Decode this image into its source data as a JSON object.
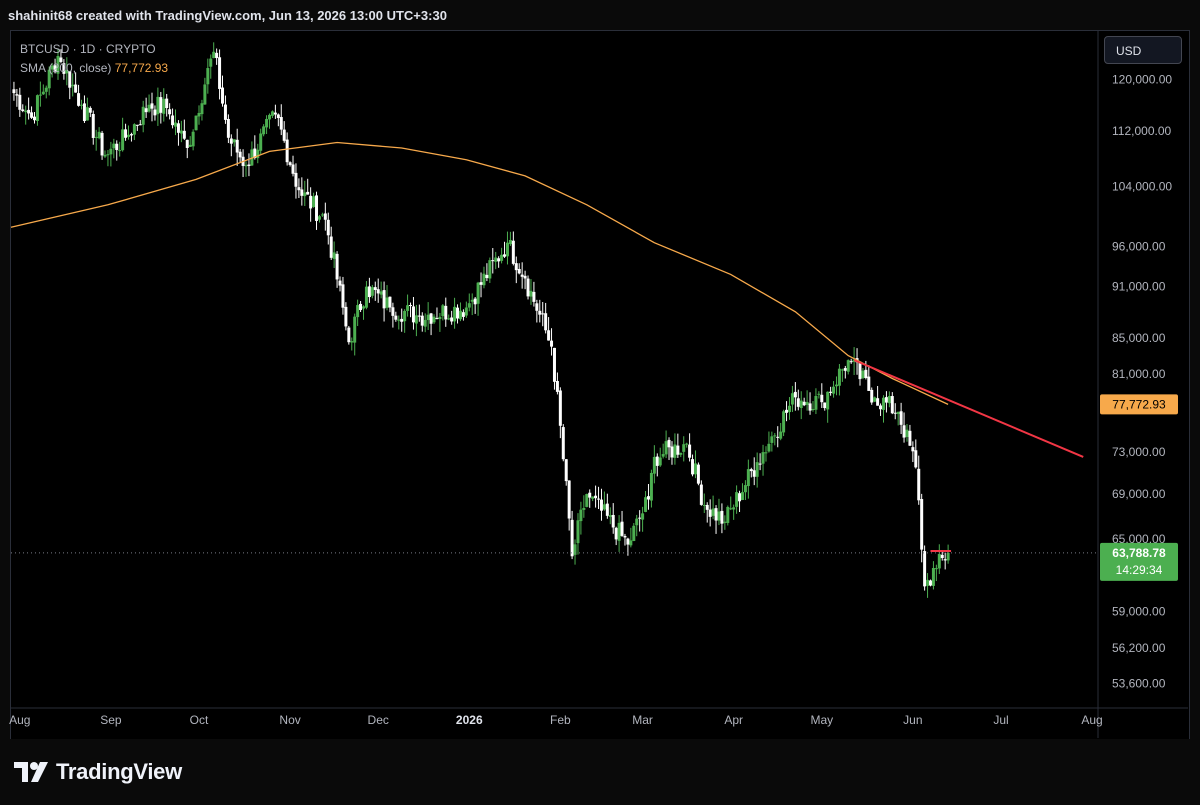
{
  "header": {
    "attribution": "shahinit68 created with TradingView.com, Jun 13, 2026 13:00 UTC+3:30"
  },
  "legend": {
    "symbol": "BTCUSD · 1D · CRYPTO",
    "sma_label": "SMA (200, close)",
    "sma_value": "77,772.93"
  },
  "currency_button": "USD",
  "footer": {
    "brand": "TradingView",
    "logo_icon": "tradingview-logo-icon"
  },
  "colors": {
    "up": "#26a69a",
    "up_candle": "#4caf50",
    "down_candle": "#ffffff",
    "sma": "#f7a94b",
    "trendline": "#f23645",
    "price_badge": "#4caf50",
    "sma_badge": "#f7a94b"
  },
  "chart_data": {
    "type": "candlestick",
    "symbol": "BTCUSD",
    "interval": "1D",
    "ylim": [
      52000,
      128000
    ],
    "y_ticks": [
      {
        "value": 120000,
        "label": "120,000.00"
      },
      {
        "value": 112000,
        "label": "112,000.00"
      },
      {
        "value": 104000,
        "label": "104,000.00"
      },
      {
        "value": 96000,
        "label": "96,000.00"
      },
      {
        "value": 91000,
        "label": "91,000.00"
      },
      {
        "value": 85000,
        "label": "85,000.00"
      },
      {
        "value": 81000,
        "label": "81,000.00"
      },
      {
        "value": 73000,
        "label": "73,000.00"
      },
      {
        "value": 69000,
        "label": "69,000.00"
      },
      {
        "value": 65000,
        "label": "65,000.00"
      },
      {
        "value": 59000,
        "label": "59,000.00"
      },
      {
        "value": 56200,
        "label": "56,200.00"
      },
      {
        "value": 53600,
        "label": "53,600.00"
      }
    ],
    "x_ticks": [
      {
        "date": "2025-08-01",
        "label": "Aug",
        "bold": false
      },
      {
        "date": "2025-09-01",
        "label": "Sep",
        "bold": false
      },
      {
        "date": "2025-10-01",
        "label": "Oct",
        "bold": false
      },
      {
        "date": "2025-11-01",
        "label": "Nov",
        "bold": false
      },
      {
        "date": "2025-12-01",
        "label": "Dec",
        "bold": false
      },
      {
        "date": "2026-01-01",
        "label": "2026",
        "bold": true
      },
      {
        "date": "2026-02-01",
        "label": "Feb",
        "bold": false
      },
      {
        "date": "2026-03-01",
        "label": "Mar",
        "bold": false
      },
      {
        "date": "2026-04-01",
        "label": "Apr",
        "bold": false
      },
      {
        "date": "2026-05-01",
        "label": "May",
        "bold": false
      },
      {
        "date": "2026-06-01",
        "label": "Jun",
        "bold": false
      },
      {
        "date": "2026-07-01",
        "label": "Jul",
        "bold": false
      },
      {
        "date": "2026-08-01",
        "label": "Aug",
        "bold": false
      }
    ],
    "x_range": [
      "2025-07-29",
      "2026-08-02"
    ],
    "price_anchors": [
      [
        "2025-07-29",
        118500
      ],
      [
        "2025-08-05",
        114000
      ],
      [
        "2025-08-14",
        123800
      ],
      [
        "2025-08-22",
        116000
      ],
      [
        "2025-08-30",
        108500
      ],
      [
        "2025-09-06",
        111000
      ],
      [
        "2025-09-14",
        116000
      ],
      [
        "2025-09-20",
        115500
      ],
      [
        "2025-09-27",
        109500
      ],
      [
        "2025-10-06",
        124500
      ],
      [
        "2025-10-11",
        111000
      ],
      [
        "2025-10-17",
        107000
      ],
      [
        "2025-10-27",
        114500
      ],
      [
        "2025-11-04",
        103500
      ],
      [
        "2025-11-13",
        99500
      ],
      [
        "2025-11-21",
        84500
      ],
      [
        "2025-11-27",
        91000
      ],
      [
        "2025-12-05",
        88500
      ],
      [
        "2025-12-15",
        87500
      ],
      [
        "2025-12-31",
        88500
      ],
      [
        "2026-01-14",
        96500
      ],
      [
        "2026-01-20",
        92000
      ],
      [
        "2026-01-29",
        84000
      ],
      [
        "2026-02-05",
        63500
      ],
      [
        "2026-02-10",
        69000
      ],
      [
        "2026-02-24",
        64500
      ],
      [
        "2026-03-03",
        68500
      ],
      [
        "2026-03-05",
        72500
      ],
      [
        "2026-03-16",
        73800
      ],
      [
        "2026-03-22",
        68000
      ],
      [
        "2026-03-29",
        66500
      ],
      [
        "2026-04-09",
        72000
      ],
      [
        "2026-04-22",
        78500
      ],
      [
        "2026-05-01",
        78000
      ],
      [
        "2026-05-10",
        82500
      ],
      [
        "2026-05-19",
        78500
      ],
      [
        "2026-05-27",
        77000
      ],
      [
        "2026-06-02",
        71500
      ],
      [
        "2026-06-05",
        61000
      ],
      [
        "2026-06-09",
        62500
      ],
      [
        "2026-06-13",
        63788.78
      ]
    ],
    "sma_200": {
      "label": "SMA (200, close)",
      "last": 77772.93,
      "points": [
        [
          "2025-07-29",
          98500
        ],
        [
          "2025-08-31",
          101500
        ],
        [
          "2025-09-30",
          105000
        ],
        [
          "2025-10-25",
          109000
        ],
        [
          "2025-11-17",
          110300
        ],
        [
          "2025-12-09",
          109500
        ],
        [
          "2025-12-31",
          107800
        ],
        [
          "2026-01-20",
          105500
        ],
        [
          "2026-02-10",
          101500
        ],
        [
          "2026-03-05",
          96500
        ],
        [
          "2026-03-31",
          92500
        ],
        [
          "2026-04-22",
          88000
        ],
        [
          "2026-05-10",
          83000
        ],
        [
          "2026-05-25",
          80500
        ],
        [
          "2026-06-13",
          77772.93
        ]
      ]
    },
    "trendline": {
      "from": [
        "2026-05-12",
        82500
      ],
      "to": [
        "2026-07-29",
        72500
      ]
    },
    "resistance_marker": {
      "from": [
        "2026-06-07",
        63950
      ],
      "to": [
        "2026-06-14",
        63950
      ]
    },
    "last_price": {
      "value": 63788.78,
      "label": "63,788.78",
      "countdown": "14:29:34"
    },
    "sma_badge": {
      "label": "77,772.93"
    }
  }
}
